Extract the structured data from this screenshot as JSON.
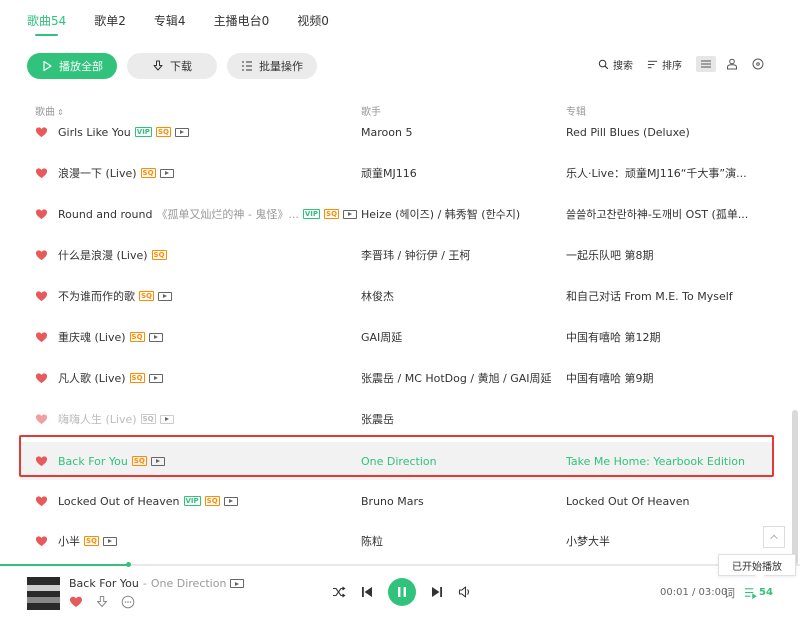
{
  "colors": {
    "accent": "#31c27c",
    "heart": "#e85a5a",
    "sq": "#ff8c00",
    "highlight_box": "#e53935"
  },
  "tabs": [
    {
      "label": "歌曲54",
      "active": true
    },
    {
      "label": "歌单2",
      "active": false
    },
    {
      "label": "专辑4",
      "active": false
    },
    {
      "label": "主播电台0",
      "active": false
    },
    {
      "label": "视频0",
      "active": false
    }
  ],
  "actions": {
    "play_all": "播放全部",
    "download": "下载",
    "batch": "批量操作"
  },
  "tools": {
    "search": "搜索",
    "sort": "排序"
  },
  "columns": {
    "song": "歌曲",
    "artist": "歌手",
    "album": "专辑"
  },
  "songs": [
    {
      "title": "Girls Like You",
      "subtitle": "",
      "badges": [
        "VIP",
        "SQ"
      ],
      "mv": true,
      "artist": "Maroon 5",
      "album": "Red Pill Blues (Deluxe)"
    },
    {
      "title": "浪漫一下 (Live)",
      "subtitle": "",
      "badges": [
        "SQ"
      ],
      "mv": true,
      "artist": "顽童MJ116",
      "album": "乐人·Live：顽童MJ116“千大事”演..."
    },
    {
      "title": "Round and round",
      "subtitle": "《孤单又灿烂的神 - 鬼怪》...",
      "badges": [
        "VIP",
        "SQ"
      ],
      "mv": true,
      "artist": "Heize (헤이즈) / 韩秀智 (한수지)",
      "album": "쓸쓸하고찬란하神-도깨비 OST (孤单..."
    },
    {
      "title": "什么是浪漫 (Live)",
      "subtitle": "",
      "badges": [
        "SQ"
      ],
      "mv": false,
      "artist": "李晋玮 / 钟衍伊 / 王柯",
      "album": "一起乐队吧 第8期"
    },
    {
      "title": "不为谁而作的歌",
      "subtitle": "",
      "badges": [
        "SQ"
      ],
      "mv": true,
      "artist": "林俊杰",
      "album": "和自己对话 From M.E. To Myself"
    },
    {
      "title": "重庆魂 (Live)",
      "subtitle": "",
      "badges": [
        "SQ"
      ],
      "mv": true,
      "artist": "GAI周延",
      "album": "中国有嘻哈 第12期"
    },
    {
      "title": "凡人歌 (Live)",
      "subtitle": "",
      "badges": [
        "SQ"
      ],
      "mv": true,
      "artist": "张震岳 / MC HotDog / 黄旭 / GAI周延",
      "album": "中国有嘻哈 第9期"
    },
    {
      "title": "嗨嗨人生 (Live)",
      "subtitle": "",
      "badges": [
        "SQ"
      ],
      "mv": true,
      "artist": "张震岳",
      "album": "",
      "dim": true
    },
    {
      "title": "Back For You",
      "subtitle": "",
      "badges": [
        "SQ"
      ],
      "mv": true,
      "artist": "One Direction",
      "album": "Take Me Home: Yearbook Edition",
      "highlighted": true
    },
    {
      "title": "Locked Out of Heaven",
      "subtitle": "",
      "badges": [
        "VIP",
        "SQ"
      ],
      "mv": true,
      "artist": "Bruno Mars",
      "album": "Locked Out Of Heaven"
    },
    {
      "title": "小半",
      "subtitle": "",
      "badges": [
        "SQ"
      ],
      "mv": true,
      "artist": "陈粒",
      "album": "小梦大半"
    }
  ],
  "player": {
    "title": "Back For You",
    "separator": "-",
    "artist": "One Direction",
    "time": "00:01 / 03:00",
    "lyric_label": "词",
    "queue_count": "54",
    "tooltip": "已开始播放",
    "progress_fraction": 0.16
  }
}
